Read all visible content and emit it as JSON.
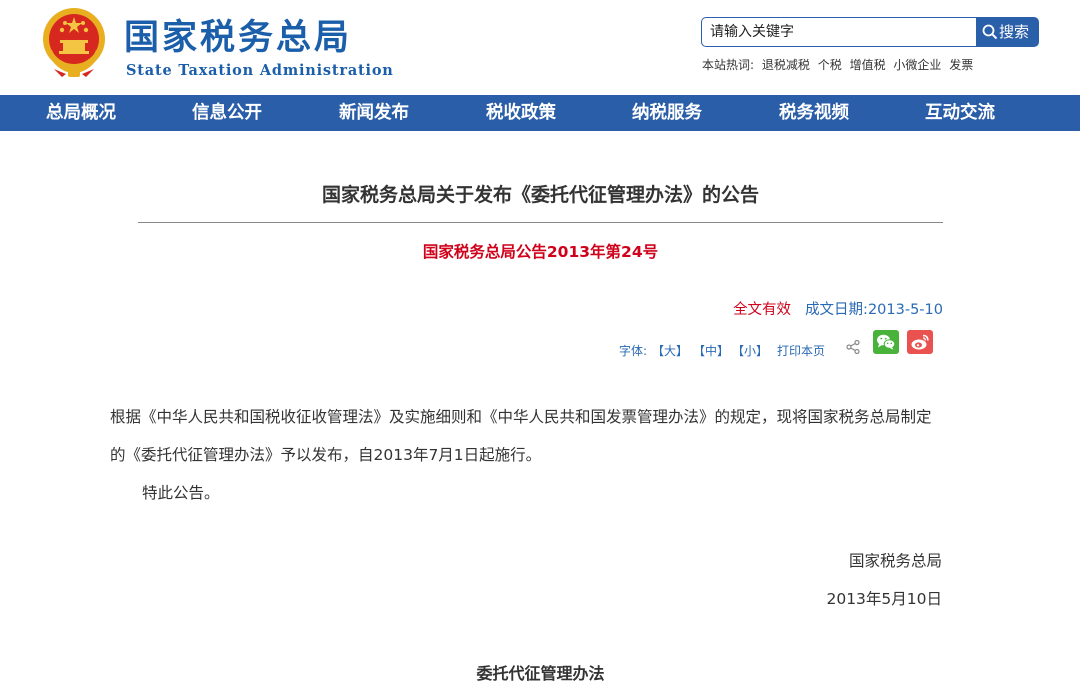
{
  "header": {
    "title_cn": "国家税务总局",
    "title_en": "State Taxation Administration",
    "emblem": "national-emblem",
    "search": {
      "value": "请输入关键字",
      "button_label": "搜索",
      "button_icon": "search-icon"
    },
    "hot_words": {
      "label": "本站热词:",
      "items": [
        "退税减税",
        "个税",
        "增值税",
        "小微企业",
        "发票"
      ]
    }
  },
  "nav": {
    "items": [
      "总局概况",
      "信息公开",
      "新闻发布",
      "税收政策",
      "纳税服务",
      "税务视频",
      "互动交流"
    ],
    "background": "#2b5ea8"
  },
  "article": {
    "title": "国家税务总局关于发布《委托代征管理办法》的公告",
    "doc_number": "国家税务总局公告2013年第24号",
    "validity": "全文有效",
    "date_label": "成文日期:2013-5-10",
    "tools": {
      "font_label": "字体:",
      "large": "【大】",
      "medium": "【中】",
      "small": "【小】",
      "print": "打印本页"
    },
    "share_icons": [
      "share-icon",
      "wechat-icon",
      "weibo-icon"
    ],
    "paragraphs": [
      "根据《中华人民共和国税收征收管理法》及实施细则和《中华人民共和国发票管理办法》的规定，现将国家税务总局制定的《委托代征管理办法》予以发布，自2013年7月1日起施行。",
      "特此公告。"
    ],
    "signature": {
      "org": "国家税务总局",
      "date": "2013年5月10日"
    },
    "sub_title": "委托代征管理办法"
  },
  "colors": {
    "brand_blue": "#1b5eaa",
    "accent_red": "#d0021b",
    "link_blue": "#2a6ab4"
  }
}
